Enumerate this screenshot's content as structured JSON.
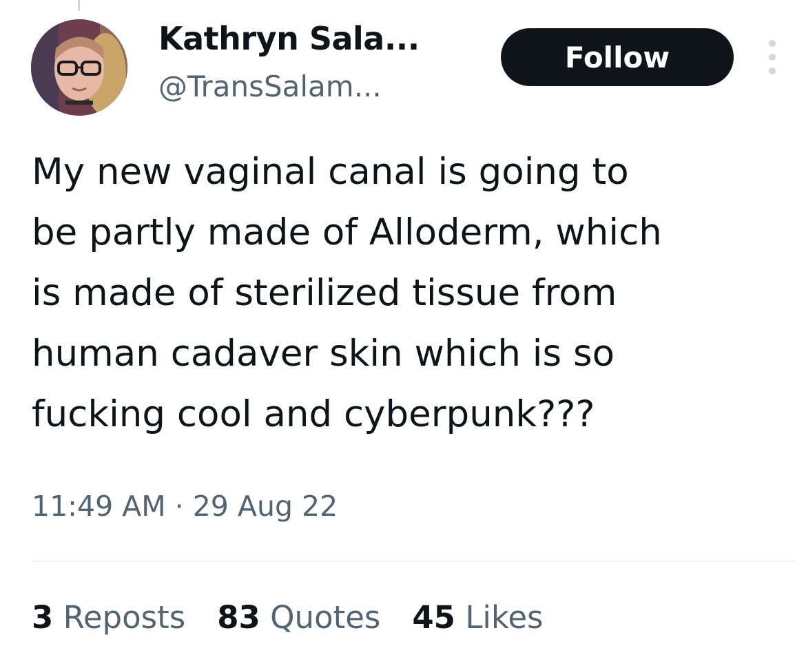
{
  "tweet": {
    "author": {
      "display_name": "Kathryn Sala...",
      "handle": "@TransSalam..."
    },
    "follow_label": "Follow",
    "text_lines": [
      "My new vaginal canal is going to",
      "be partly made of Alloderm, which",
      "is made of sterilized tissue from",
      "human cadaver skin which is so",
      "fucking cool and cyberpunk???"
    ],
    "timestamp": "11:49 AM · 29 Aug 22",
    "stats": [
      {
        "count": "3",
        "label": "Reposts"
      },
      {
        "count": "83",
        "label": "Quotes"
      },
      {
        "count": "45",
        "label": "Likes"
      }
    ]
  },
  "colors": {
    "text_primary": "#0f1419",
    "text_secondary": "#536471",
    "button_bg": "#0f1419",
    "divider": "#eff3f4"
  },
  "icons": {
    "more": "more-options-icon",
    "avatar": "avatar"
  }
}
